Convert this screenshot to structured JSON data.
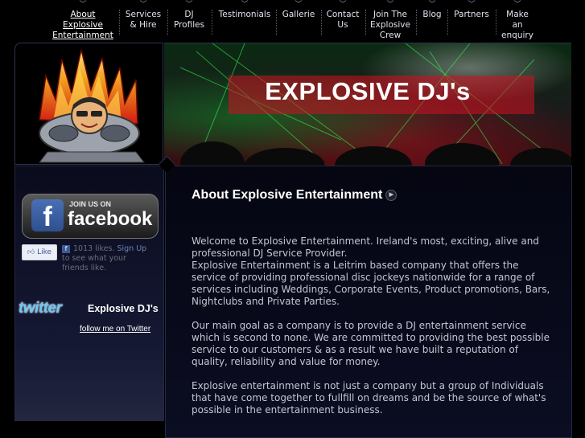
{
  "nav": {
    "items": [
      {
        "label": "About\nExplosive\nEntertainment",
        "active": true
      },
      {
        "label": "Services\n& Hire"
      },
      {
        "label": "DJ\nProfiles"
      },
      {
        "label": "Testimonials"
      },
      {
        "label": "Gallerie"
      },
      {
        "label": "Contact\nUs"
      },
      {
        "label": "Join The\nExplosive\nCrew"
      },
      {
        "label": "Blog"
      },
      {
        "label": "Partners"
      },
      {
        "label": "Make\nan\nenquiry"
      }
    ]
  },
  "header": {
    "banner_title": "EXPLOSIVE DJ's"
  },
  "sidebar": {
    "facebook": {
      "join_text": "JOIN US ON",
      "brand_text": "facebook",
      "like_button": "Like",
      "likes_count": "1013 likes.",
      "signup_link": "Sign Up",
      "signup_tail": " to see what your friends like."
    },
    "twitter": {
      "brand_text": "twitter",
      "account_name": "Explosive DJ's",
      "follow_link": "follow me on Twitter"
    }
  },
  "main": {
    "title": "About Explosive Entertainment",
    "paragraphs": [
      "Welcome to Explosive Entertainment. Ireland's most, exciting, alive and professional DJ Service Provider.",
      "Explosive Entertainment is a Leitrim based company that offers the service of providing professional disc jockeys nationwide for a range of services including Weddings, Corporate Events, Product promotions, Bars, Nightclubs and Private Parties.",
      "Our main goal as a company is to provide a DJ entertainment service which is second to none. We are committed to providing the best possible service to our customers & as a result we have built a reputation of quality, reliability and value for money.",
      "Explosive entertainment is not just a company but a group of Individuals that have come together to fullfill on dreams and be the source of what's possible in the entertainment business."
    ]
  },
  "colors": {
    "page_bg": "#000000",
    "panel_border": "#232843",
    "banner_text": "#ffffff",
    "link_blue": "#6d84b4",
    "twitter_blue": "#6fc6f1"
  }
}
